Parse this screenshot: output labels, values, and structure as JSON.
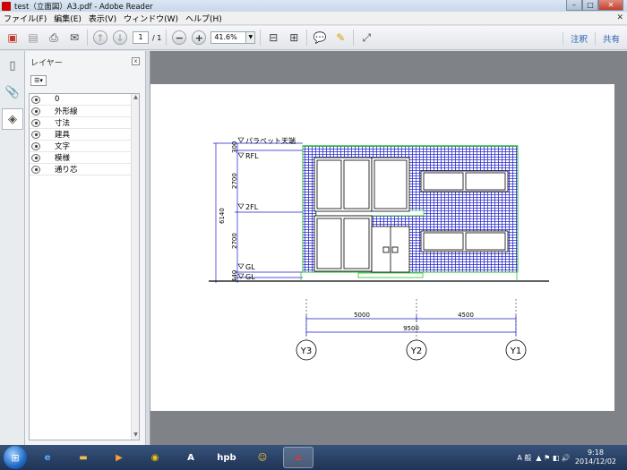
{
  "window": {
    "title": "test（立面図）A3.pdf - Adobe Reader"
  },
  "menu": [
    "ファイル(F)",
    "編集(E)",
    "表示(V)",
    "ウィンドウ(W)",
    "ヘルプ(H)"
  ],
  "toolbar": {
    "page_current": "1",
    "page_total": "/ 1",
    "zoom": "41.6%",
    "comment_label": "注釈",
    "share_label": "共有"
  },
  "layers_panel": {
    "title": "レイヤー",
    "layers": [
      "0",
      "外形線",
      "寸法",
      "建具",
      "文字",
      "模様",
      "通り芯"
    ]
  },
  "drawing": {
    "level_labels": [
      "パラペット天端",
      "RFL",
      "2FL",
      "GL",
      "GL"
    ],
    "vertical_dims": [
      "300",
      "2700",
      "2700",
      "440"
    ],
    "total_height": "6140",
    "horizontal_dims": [
      "5000",
      "4500"
    ],
    "total_width": "9500",
    "grid_axes": [
      "Y3",
      "Y2",
      "Y1"
    ],
    "colors": {
      "tile": "#2b2bd0",
      "frame": "#2fbf3a",
      "dim": "#1a1acc"
    }
  },
  "taskbar": {
    "clock_time": "9:18",
    "clock_date": "2014/12/02",
    "ime_label": "A 般"
  }
}
